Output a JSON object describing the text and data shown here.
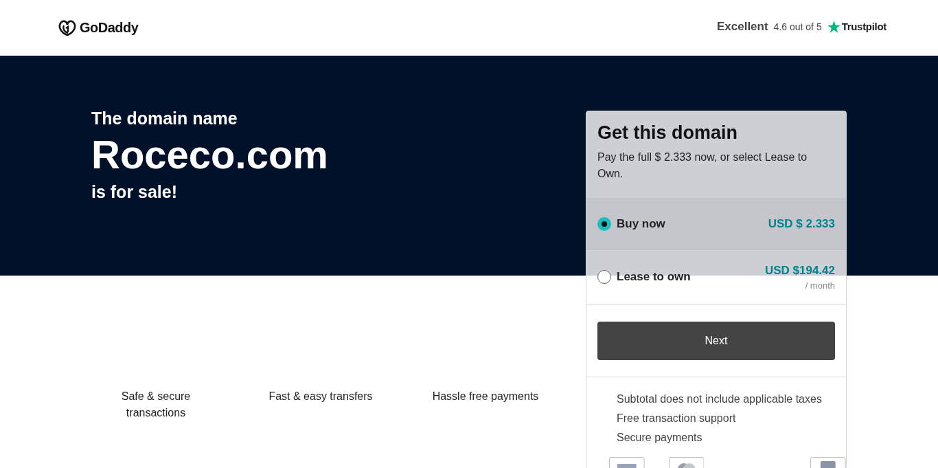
{
  "header": {
    "logo": "GoDaddy",
    "rating_label": "Excellent",
    "rating_score": "4.6 out of 5",
    "review_site": "Trustpilot"
  },
  "hero": {
    "intro": "The domain name",
    "domain": "Roceco.com",
    "outro": "is for sale!"
  },
  "features": [
    {
      "label": "Safe & secure transactions"
    },
    {
      "label": "Fast & easy transfers"
    },
    {
      "label": "Hassle free payments"
    }
  ],
  "purchase_card": {
    "title": "Get this domain",
    "description": "Pay the full $ 2.333 now, or select Lease to Own.",
    "options": [
      {
        "label": "Buy now",
        "price": "USD $ 2.333",
        "selected": true
      },
      {
        "label": "Lease to own",
        "price": "USD $194.42",
        "period": "/ month",
        "selected": false
      }
    ],
    "button": "Next",
    "notes": [
      "Subtotal does not include applicable taxes",
      "Free transaction support",
      "Secure payments"
    ]
  }
}
